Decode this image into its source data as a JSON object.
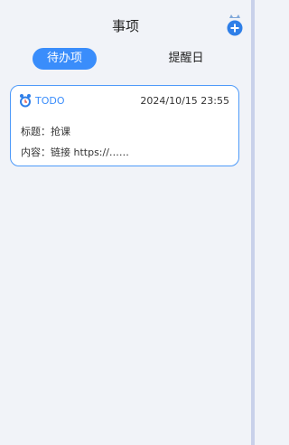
{
  "header": {
    "title": "事项",
    "add_icon": "plus-circle-cat-icon"
  },
  "tabs": [
    {
      "label": "待办项",
      "active": true
    },
    {
      "label": "提醒日",
      "active": false
    }
  ],
  "card": {
    "icon": "alarm-clock-icon",
    "tag": "TODO",
    "datetime": "2024/10/15 23:55",
    "title_line": "标题：抢课",
    "content_line": "内容：链接 https://……"
  },
  "colors": {
    "accent": "#3a8dfb",
    "background": "#f1f3f8",
    "card_border": "#4e9af9"
  }
}
